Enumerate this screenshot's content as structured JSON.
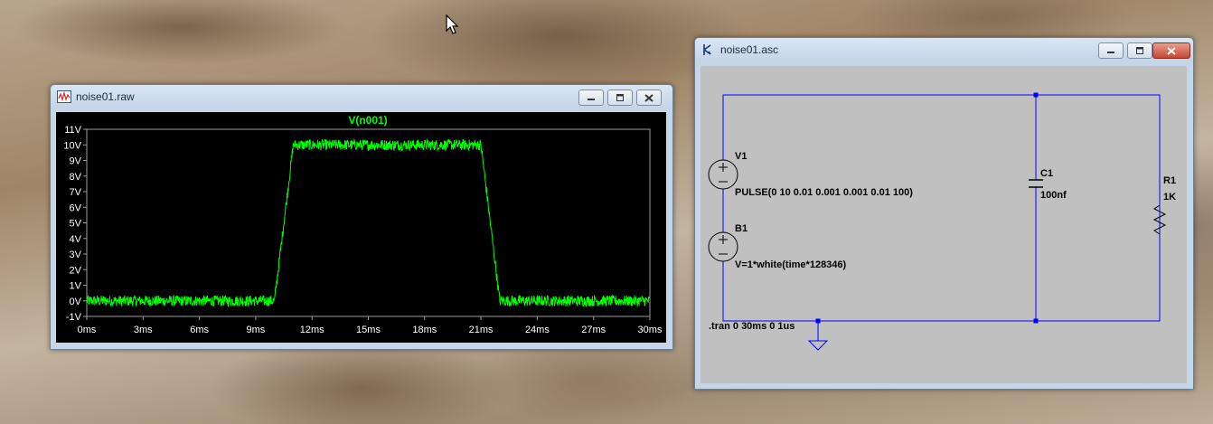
{
  "raw_window": {
    "title": "noise01.raw",
    "icon": "waveform-icon",
    "buttons": [
      "minimize",
      "maximize",
      "close"
    ]
  },
  "asc_window": {
    "title": "noise01.asc",
    "icon": "ltspice-schematic-icon",
    "buttons": [
      "minimize",
      "maximize",
      "close"
    ]
  },
  "chart_data": {
    "type": "line",
    "title": "V(n001)",
    "xlabel": "",
    "ylabel": "",
    "x_ticks": [
      "0ms",
      "3ms",
      "6ms",
      "9ms",
      "12ms",
      "15ms",
      "18ms",
      "21ms",
      "24ms",
      "27ms",
      "30ms"
    ],
    "y_ticks": [
      "11V",
      "10V",
      "9V",
      "8V",
      "7V",
      "6V",
      "5V",
      "4V",
      "3V",
      "2V",
      "1V",
      "0V",
      "-1V"
    ],
    "xlim": [
      0,
      30
    ],
    "ylim": [
      -1,
      11
    ],
    "x_unit": "ms",
    "y_unit": "V",
    "grid": false,
    "series": [
      {
        "name": "V(n001)",
        "color": "#00ff00",
        "noise_amplitude": 0.35,
        "x": [
          0,
          10,
          11,
          21,
          22,
          30
        ],
        "y": [
          0,
          0,
          10,
          10,
          0,
          0
        ]
      }
    ],
    "colors": {
      "background": "#000000",
      "axes": "#9c9c9c",
      "labels": "#ffffff",
      "title": "#00ff00"
    }
  },
  "schematic": {
    "v1": {
      "name": "V1",
      "value": "PULSE(0 10 0.01 0.001 0.001 0.01 100)"
    },
    "b1": {
      "name": "B1",
      "value": "V=1*white(time*128346)"
    },
    "c1": {
      "name": "C1",
      "value": "100nf"
    },
    "r1": {
      "name": "R1",
      "value": "1K"
    },
    "directive": ".tran 0 30ms 0 1us",
    "colors": {
      "wire": "#0000ff",
      "component": "#000000",
      "background": "#c0c0c0"
    }
  }
}
